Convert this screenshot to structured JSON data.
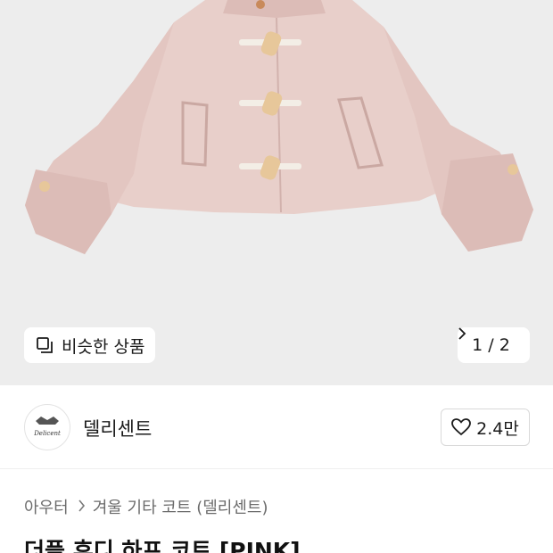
{
  "hero": {
    "similar_label": "비슷한 상품",
    "page_indicator": "1 / 2",
    "colors": {
      "background": "#ededed",
      "coat": "#e8cfca",
      "toggle": "#e7c79a",
      "rope": "#f3eee6"
    }
  },
  "brand": {
    "logo_text": "Delicent",
    "name": "델리센트",
    "likes": "2.4만"
  },
  "breadcrumb": {
    "category": "아우터",
    "subcategory": "겨울 기타 코트 (델리센트)"
  },
  "product": {
    "title": "더플 후디 하프 코트 [PINK]"
  }
}
